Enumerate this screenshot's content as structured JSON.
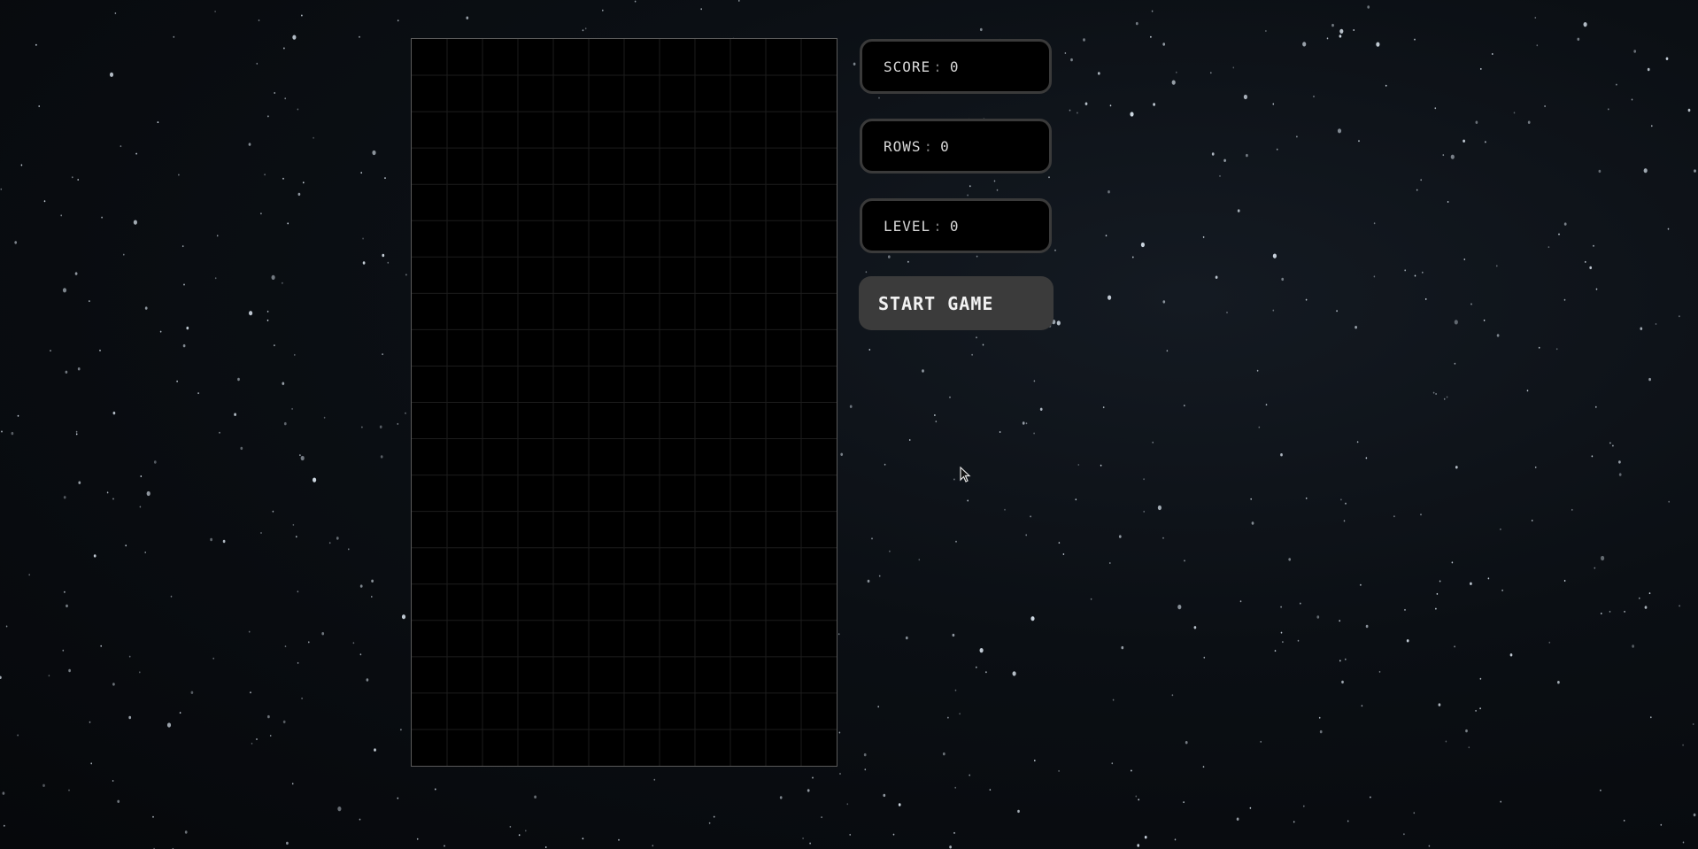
{
  "stats": {
    "score_label": "SCORE",
    "score_value": "0",
    "rows_label": "ROWS",
    "rows_value": "0",
    "level_label": "LEVEL",
    "level_value": "0",
    "separator": ":"
  },
  "controls": {
    "start_label": "START GAME"
  },
  "board": {
    "columns": 12,
    "rows": 20,
    "background_color": "#000000",
    "grid_color": "#1c1c1c"
  },
  "colors": {
    "panel_border": "#3a3a3a",
    "button_bg": "#3b3b3b",
    "text": "#d8d8d8"
  }
}
